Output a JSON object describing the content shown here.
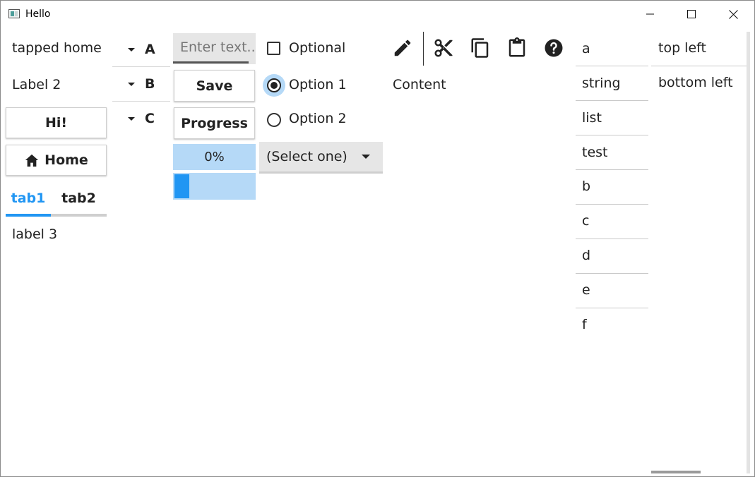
{
  "window": {
    "title": "Hello"
  },
  "left": {
    "label1": "tapped home",
    "label2": "Label 2",
    "hi_button": "Hi!",
    "home_button": "Home",
    "tabs": [
      {
        "label": "tab1",
        "active": true
      },
      {
        "label": "tab2",
        "active": false
      }
    ],
    "tab_content": "label 3"
  },
  "accordion": {
    "items": [
      {
        "label": "A"
      },
      {
        "label": "B"
      },
      {
        "label": "C"
      }
    ]
  },
  "form": {
    "entry_placeholder": "Enter text...",
    "save_label": "Save",
    "progress_button": "Progress",
    "progress_value_text": "0%",
    "progress_fraction": 0.0,
    "infinite_progress_fraction": 0.18
  },
  "options": {
    "checkbox_label": "Optional",
    "checkbox_checked": false,
    "radio_options": [
      {
        "label": "Option 1",
        "selected": true
      },
      {
        "label": "Option 2",
        "selected": false
      }
    ],
    "select_value": "(Select one)"
  },
  "toolbar": {
    "icons": [
      "edit-icon",
      "cut-icon",
      "copy-icon",
      "paste-icon",
      "help-icon"
    ],
    "content_label": "Content"
  },
  "list": {
    "items": [
      "a",
      "string",
      "list",
      "test",
      "b",
      "c",
      "d",
      "e",
      "f"
    ]
  },
  "split": {
    "top": "top left",
    "bottom": "bottom left"
  },
  "colors": {
    "accent": "#2196f3",
    "accent_light": "#b5d9f7",
    "tab_inactive_line": "#cfcfcf"
  }
}
